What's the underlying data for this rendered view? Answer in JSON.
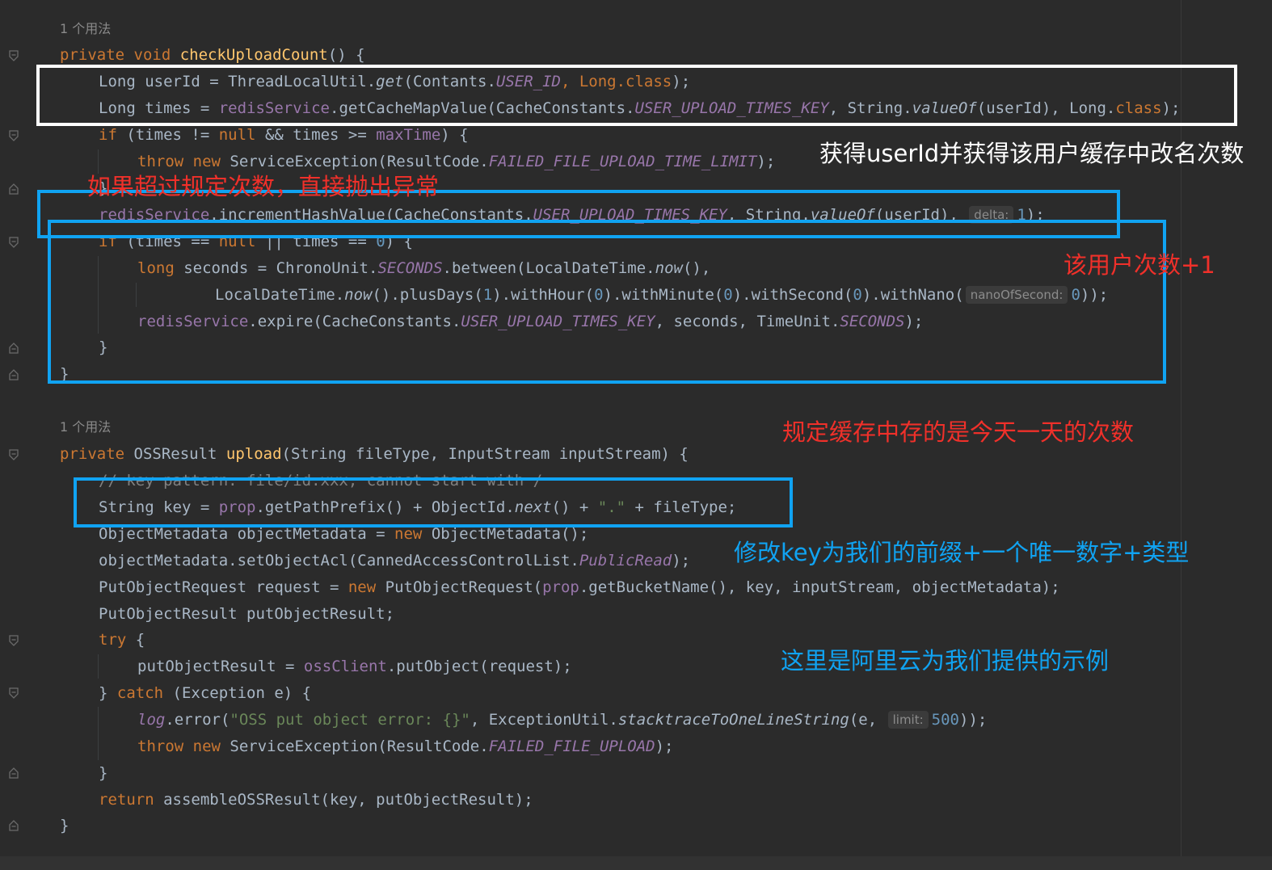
{
  "usage_hint": "1 个用法",
  "method1": {
    "l1": {
      "kw": "private void ",
      "name": "checkUploadCount",
      "rest": "() {"
    },
    "l2": {
      "a": "Long userId = ThreadLocalUtil.",
      "b": "get",
      "c": "(Contants.",
      "d": "USER_ID",
      "e": ", Long.",
      "f": "class",
      "g": ");"
    },
    "l3": {
      "a": "Long times = ",
      "b": "redisService",
      "c": ".getCacheMapValue(CacheConstants.",
      "d": "USER_UPLOAD_TIMES_KEY",
      "e": ", String.",
      "f": "valueOf",
      "g": "(userId), Long.",
      "h": "class",
      "i": ");"
    },
    "l4": {
      "a": "if",
      "b": " (times != ",
      "c": "null",
      "d": " && times >= ",
      "e": "maxTime",
      "f": ") {"
    },
    "l5": {
      "a": "throw new ",
      "b": "ServiceException(ResultCode.",
      "c": "FAILED_FILE_UPLOAD_TIME_LIMIT",
      "d": ");"
    },
    "l6": {
      "a": "}"
    },
    "l7": {
      "a": "redisService",
      "b": ".incrementHashValue(CacheConstants.",
      "c": "USER_UPLOAD_TIMES_KEY",
      "d": ", String.",
      "e": "valueOf",
      "f": "(userId), ",
      "hint": "delta:",
      "g": "1",
      "h": ");"
    },
    "l8": {
      "a": "if",
      "b": " (times == ",
      "c": "null",
      "d": " || times == ",
      "e": "0",
      "f": ") {"
    },
    "l9": {
      "a": "long",
      "b": " seconds = ChronoUnit.",
      "c": "SECONDS",
      "d": ".between(LocalDateTime.",
      "e": "now",
      "f": "(),"
    },
    "l10": {
      "a": "LocalDateTime.",
      "b": "now",
      "c": "().plusDays(",
      "d": "1",
      "e": ").withHour(",
      "f": "0",
      "g": ").withMinute(",
      "h": "0",
      "i": ").withSecond(",
      "j": "0",
      "k": ").withNano(",
      "hint": "nanoOfSecond:",
      "l": "0",
      "m": "));"
    },
    "l11": {
      "a": "redisService",
      "b": ".expire(CacheConstants.",
      "c": "USER_UPLOAD_TIMES_KEY",
      "d": ", seconds, TimeUnit.",
      "e": "SECONDS",
      "f": ");"
    },
    "l12": {
      "a": "}"
    },
    "l13": {
      "a": "}"
    }
  },
  "method2": {
    "l1": {
      "kw": "private ",
      "type": "OSSResult ",
      "name": "upload",
      "rest": "(String fileType, InputStream inputStream) {"
    },
    "l2": {
      "a": "// key pattern: file/id.xxx, cannot start with /"
    },
    "l3": {
      "a": "String key = ",
      "b": "prop",
      "c": ".getPathPrefix() + ObjectId.",
      "d": "next",
      "e": "() + ",
      "f": "\".\"",
      "g": " + fileType;"
    },
    "l4": {
      "a": "ObjectMetadata objectMetadata = ",
      "b": "new",
      "c": " ObjectMetadata();"
    },
    "l5": {
      "a": "objectMetadata.setObjectAcl(CannedAccessControlList.",
      "b": "PublicRead",
      "c": ");"
    },
    "l6": {
      "a": "PutObjectRequest request = ",
      "b": "new",
      "c": " PutObjectRequest(",
      "d": "prop",
      "e": ".getBucketName(), key, inputStream, objectMetadata);"
    },
    "l7": {
      "a": "PutObjectResult putObjectResult;"
    },
    "l8": {
      "a": "try",
      "b": " {"
    },
    "l9": {
      "a": "putObjectResult = ",
      "b": "ossClient",
      "c": ".putObject(request);"
    },
    "l10": {
      "a": "} ",
      "b": "catch",
      "c": " (Exception e) {"
    },
    "l11": {
      "a": "log",
      "b": ".error(",
      "c": "\"OSS put object error: {}\"",
      "d": ", ExceptionUtil.",
      "e": "stacktraceToOneLineString",
      "f": "(e, ",
      "hint": "limit:",
      "g": "500",
      "h": "));"
    },
    "l12": {
      "a": "throw new ",
      "b": "ServiceException(ResultCode.",
      "c": "FAILED_FILE_UPLOAD",
      "d": ");"
    },
    "l13": {
      "a": "}"
    },
    "l14": {
      "a": "return",
      "b": " assembleOSSResult(key, putObjectResult);"
    },
    "l15": {
      "a": "}"
    }
  },
  "annotations": {
    "get_user_times": "获得userId并获得该用户缓存中改名次数",
    "throw_if_exceeded": "如果超过规定次数，直接抛出异常",
    "increment": "该用户次数+1",
    "today_cache": "规定缓存中存的是今天一天的次数",
    "key_format": "修改key为我们的前缀+一个唯一数字+类型",
    "aliyun_example": "这里是阿里云为我们提供的示例"
  },
  "colors": {
    "background": "#2b2b2b",
    "keyword": "#cc7832",
    "method_decl": "#ffc66d",
    "field": "#9876aa",
    "string": "#6a8759",
    "number": "#6897bb",
    "annotation_red": "#f0302a",
    "annotation_blue": "#10a3f2",
    "annotation_white": "#ffffff"
  }
}
